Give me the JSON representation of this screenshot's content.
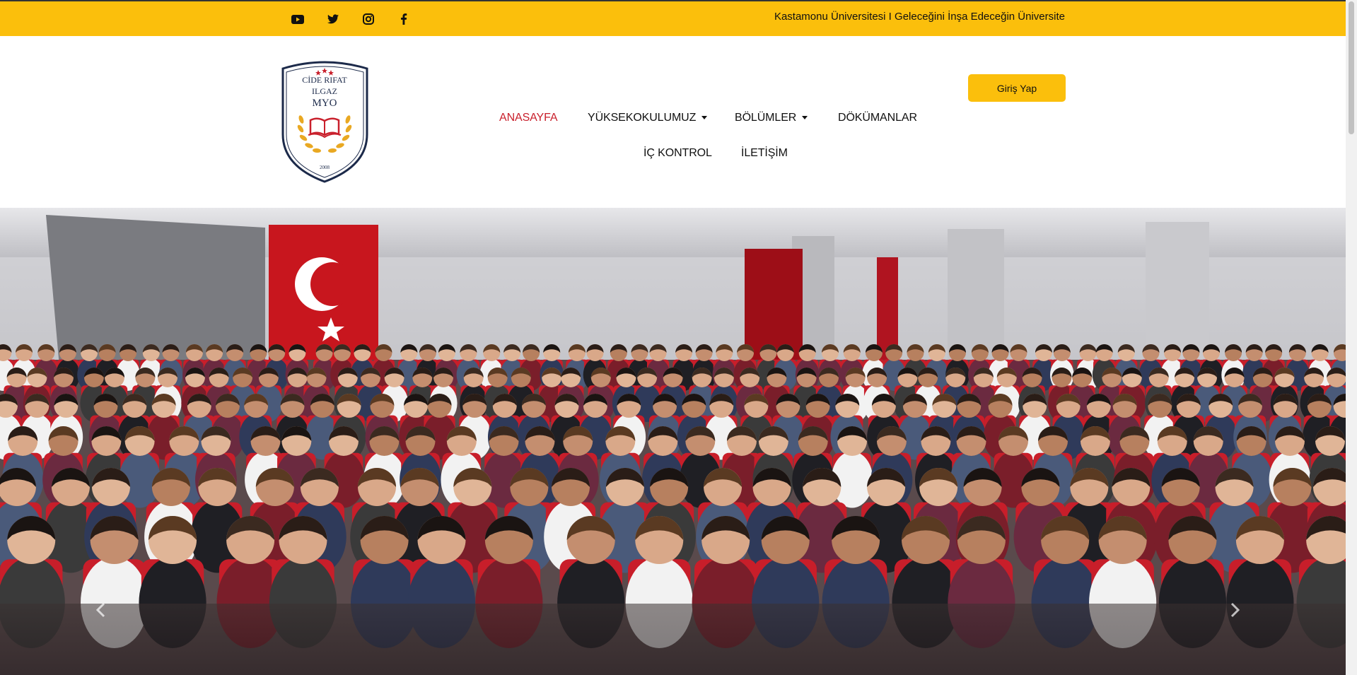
{
  "topbar": {
    "tagline": "Kastamonu Üniversitesi I Geleceğini İnşa Edeceğin Üniversite",
    "social": [
      "youtube-icon",
      "twitter-icon",
      "instagram-icon",
      "facebook-icon"
    ],
    "background": "#fbbf0c"
  },
  "logo": {
    "line1": "CİDE RIFAT",
    "line2": "ILGAZ",
    "line3": "MYO",
    "year": "2008"
  },
  "nav": {
    "items": [
      {
        "label": "ANASAYFA",
        "active": true
      },
      {
        "label": "YÜKSEKOKULUMUZ",
        "dropdown": true
      },
      {
        "label": "BÖLÜMLER",
        "dropdown": true
      },
      {
        "label": "DÖKÜMANLAR"
      },
      {
        "label": "İÇ KONTROL"
      },
      {
        "label": "İLETİŞİM"
      }
    ],
    "active_color": "#c9202c"
  },
  "login": {
    "label": "Giriş Yap"
  },
  "hero": {
    "prev": "chevron-left-icon",
    "next": "chevron-right-icon"
  }
}
